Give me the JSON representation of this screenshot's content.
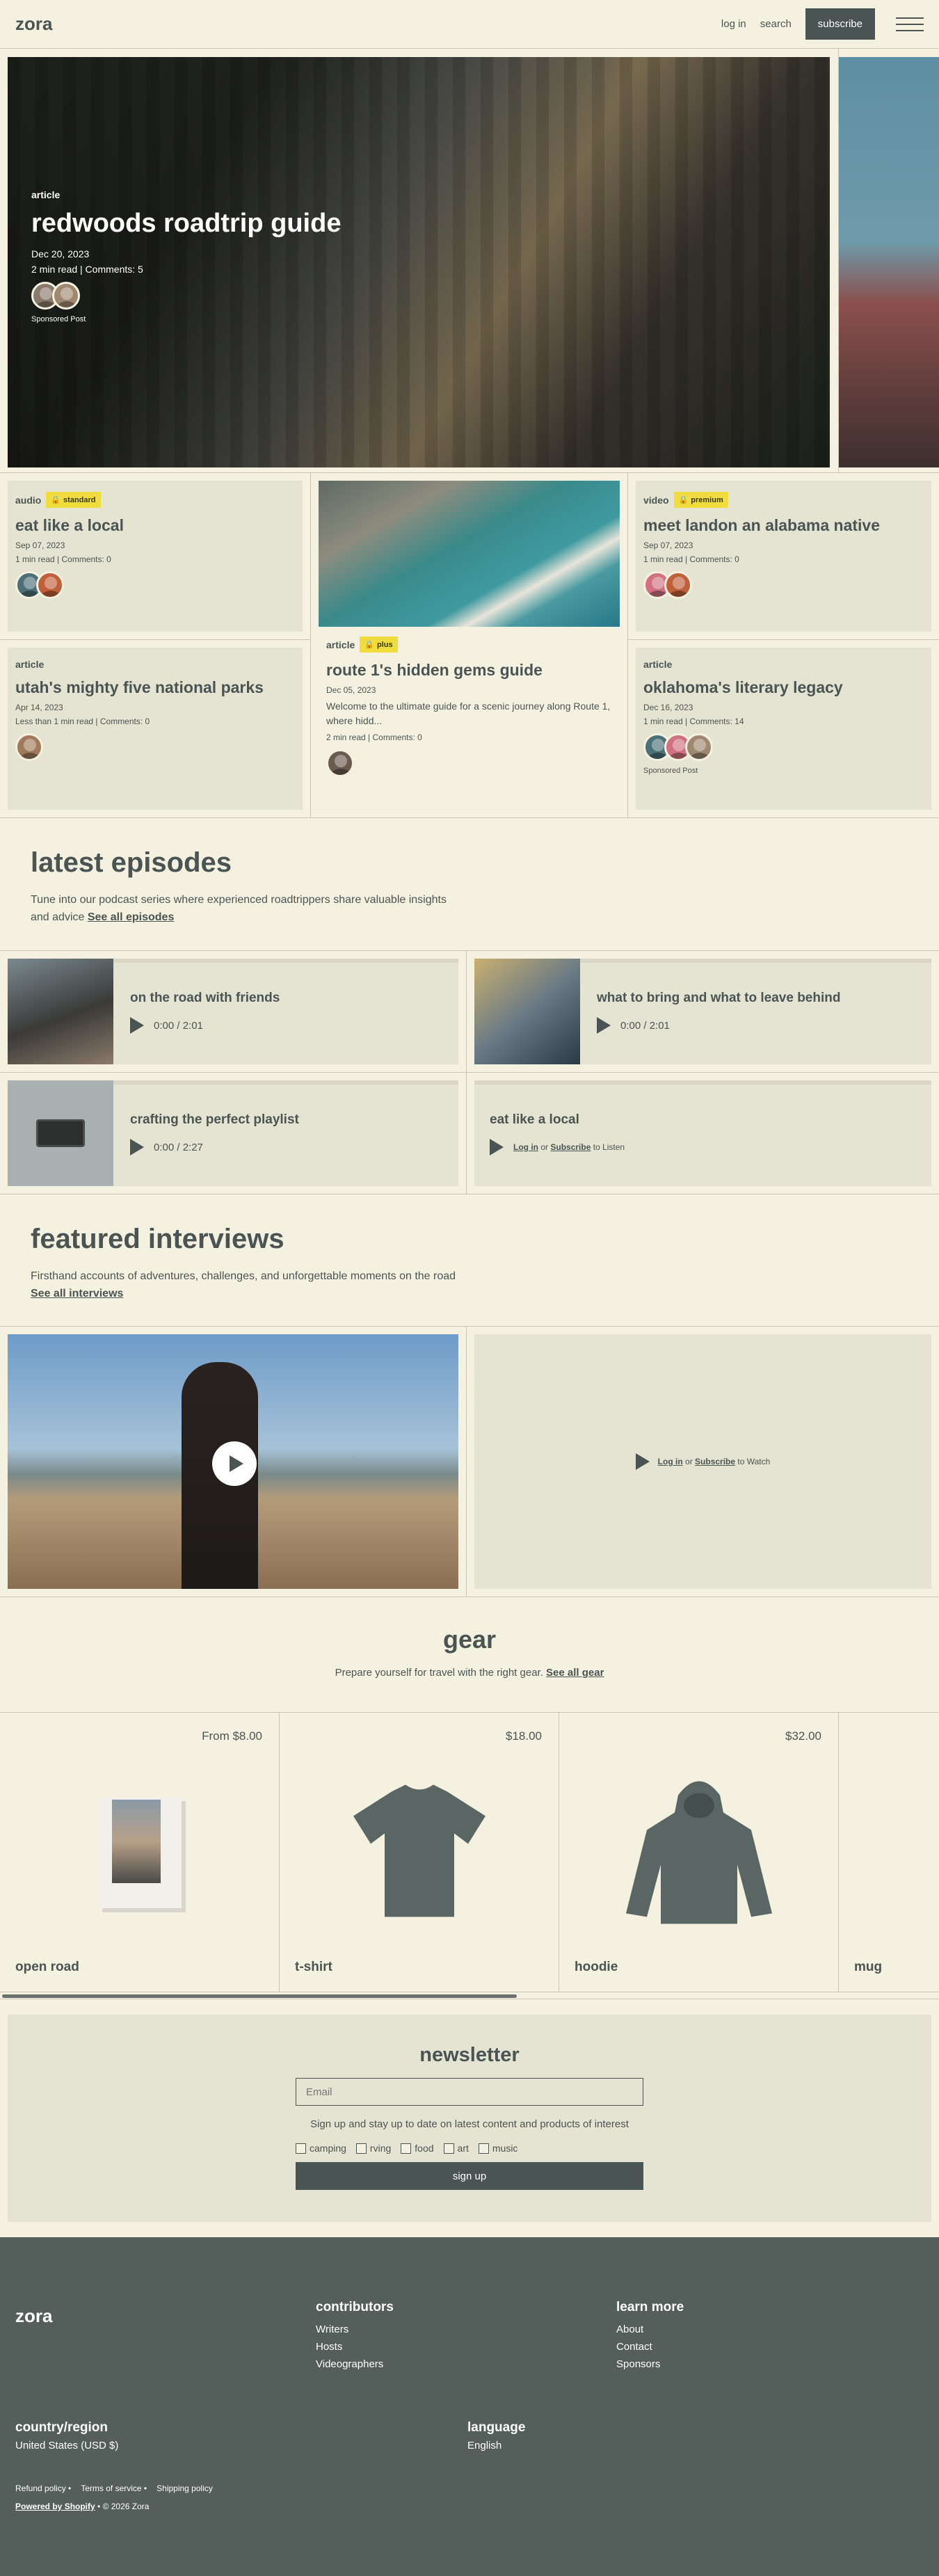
{
  "header": {
    "logo": "zora",
    "login": "log in",
    "search": "search",
    "subscribe": "subscribe"
  },
  "hero": {
    "category": "article",
    "title": "redwoods roadtrip guide",
    "date": "Dec 20, 2023",
    "meta": "2 min read | Comments: 5",
    "sponsored": "Sponsored Post"
  },
  "articles": {
    "a1": {
      "category": "audio",
      "badge": "standard",
      "title": "eat like a local",
      "date": "Sep 07, 2023",
      "meta": "1 min read | Comments: 0"
    },
    "a2": {
      "category": "article",
      "title": "utah's mighty five national parks",
      "date": "Apr 14, 2023",
      "meta": "Less than 1 min read | Comments: 0"
    },
    "a3": {
      "category": "article",
      "badge": "plus",
      "title": "route 1's hidden gems guide",
      "date": "Dec 05, 2023",
      "desc": "Welcome to the ultimate guide for a scenic journey along Route 1, where hidd...",
      "meta": "2 min read | Comments: 0"
    },
    "a4": {
      "category": "video",
      "badge": "premium",
      "title": "meet landon an alabama native",
      "date": "Sep 07, 2023",
      "meta": "1 min read | Comments: 0"
    },
    "a5": {
      "category": "article",
      "title": "oklahoma's literary legacy",
      "date": "Dec 16, 2023",
      "meta": "1 min read | Comments: 14",
      "sponsored": "Sponsored Post"
    }
  },
  "episodes": {
    "title": "latest episodes",
    "desc": "Tune into our podcast series where experienced roadtrippers share valuable insights and advice",
    "link": "See all episodes",
    "items": [
      {
        "title": "on the road with friends",
        "time": "0:00 / 2:01"
      },
      {
        "title": "what to bring and what to leave behind",
        "time": "0:00 / 2:01"
      },
      {
        "title": "crafting the perfect playlist",
        "time": "0:00 / 2:27"
      },
      {
        "title": "eat like a local",
        "login": "Log in",
        "or": "or",
        "subscribe": "Subscribe",
        "tail": "to Listen"
      }
    ]
  },
  "interviews": {
    "title": "featured interviews",
    "desc": "Firsthand accounts of adventures, challenges, and unforgettable moments on the road",
    "link": "See all interviews",
    "locked": {
      "login": "Log in",
      "or": "or",
      "subscribe": "Subscribe",
      "tail": "to Watch"
    }
  },
  "gear": {
    "title": "gear",
    "desc": "Prepare yourself for travel with the right gear.",
    "link": "See all gear",
    "items": [
      {
        "name": "open road",
        "price": "From $8.00"
      },
      {
        "name": "t-shirt",
        "price": "$18.00"
      },
      {
        "name": "hoodie",
        "price": "$32.00"
      },
      {
        "name": "mug",
        "price": ""
      }
    ]
  },
  "newsletter": {
    "title": "newsletter",
    "placeholder": "Email",
    "sub": "Sign up and stay up to date on latest content and products of interest",
    "options": [
      "camping",
      "rving",
      "food",
      "art",
      "music"
    ],
    "button": "sign up"
  },
  "footer": {
    "logo": "zora",
    "contributors": {
      "title": "contributors",
      "links": [
        "Writers",
        "Hosts",
        "Videographers"
      ]
    },
    "learn": {
      "title": "learn more",
      "links": [
        "About",
        "Contact",
        "Sponsors"
      ]
    },
    "region": {
      "title": "country/region",
      "value": "United States (USD $)"
    },
    "language": {
      "title": "language",
      "value": "English"
    },
    "links": [
      "Refund policy •",
      "Terms of service •",
      "Shipping policy"
    ],
    "powered": "Powered by Shopify",
    "copy": "• © 2026 Zora"
  },
  "colors": {
    "accent": "#4a5553",
    "badge": "#f0dd3d",
    "background": "#f5f1e1",
    "card": "#e5e3d2"
  }
}
